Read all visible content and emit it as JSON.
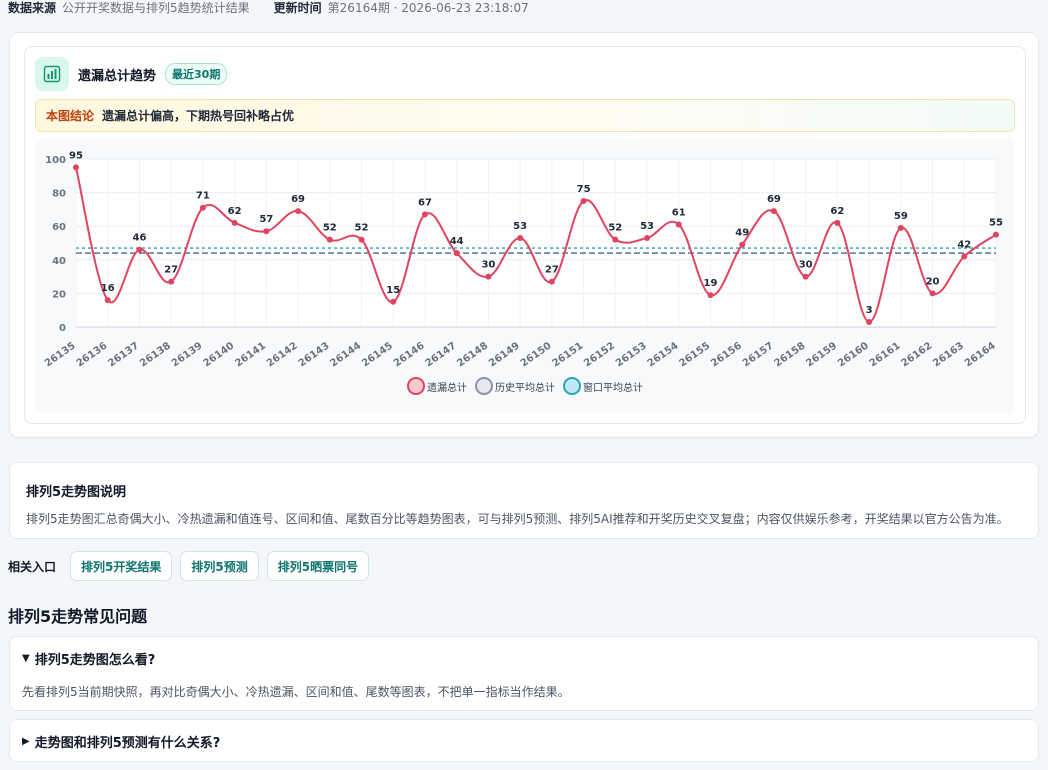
{
  "meta": {
    "source_label": "数据来源",
    "source_value": "公开开奖数据与排列5趋势统计结果",
    "updated_label": "更新时间",
    "updated_value": "第26164期 · 2026-06-23 23:18:07"
  },
  "chart_card": {
    "icon": "bar-chart-icon",
    "title": "遗漏总计趋势",
    "badge": "最近30期",
    "conclusion_tag": "本图结论",
    "conclusion_text": "遗漏总计偏高，下期热号回补略占优"
  },
  "chart_data": {
    "type": "line",
    "title": "",
    "xlabel": "",
    "ylabel": "",
    "ylim": [
      0,
      100
    ],
    "yticks": [
      0,
      20,
      40,
      60,
      80,
      100
    ],
    "grid": true,
    "legend_position": "bottom-center",
    "x": [
      "26135",
      "26136",
      "26137",
      "26138",
      "26139",
      "26140",
      "26141",
      "26142",
      "26143",
      "26144",
      "26145",
      "26146",
      "26147",
      "26148",
      "26149",
      "26150",
      "26151",
      "26152",
      "26153",
      "26154",
      "26155",
      "26156",
      "26157",
      "26158",
      "26159",
      "26160",
      "26161",
      "26162",
      "26163",
      "26164"
    ],
    "series": [
      {
        "name": "遗漏总计",
        "values": [
          95,
          16,
          46,
          27,
          71,
          62,
          57,
          69,
          52,
          52,
          15,
          67,
          44,
          30,
          53,
          27,
          75,
          52,
          53,
          61,
          19,
          49,
          69,
          30,
          62,
          3,
          59,
          20,
          42,
          55
        ],
        "color": "#e0445f"
      },
      {
        "name": "历史平均总计",
        "value": 44,
        "color": "#4b6a8b"
      },
      {
        "name": "窗口平均总计",
        "value": 47,
        "color": "#2aa3b8"
      }
    ]
  },
  "description": {
    "title": "排列5走势图说明",
    "body": "排列5走势图汇总奇偶大小、冷热遗漏和值连号、区间和值、尾数百分比等趋势图表，可与排列5预测、排列5AI推荐和开奖历史交叉复盘；内容仅供娱乐参考，开奖结果以官方公告为准。"
  },
  "related": {
    "label": "相关入口",
    "links": [
      "排列5开奖结果",
      "排列5预测",
      "排列5晒票同号"
    ]
  },
  "faq": {
    "heading": "排列5走势常见问题",
    "items": [
      {
        "marker": "▼",
        "q": "排列5走势图怎么看?",
        "a": "先看排列5当前期快照，再对比奇偶大小、冷热遗漏、区间和值、尾数等图表，不把单一指标当作结果。"
      },
      {
        "marker": "▶",
        "q": "走势图和排列5预测有什么关系?"
      }
    ]
  }
}
